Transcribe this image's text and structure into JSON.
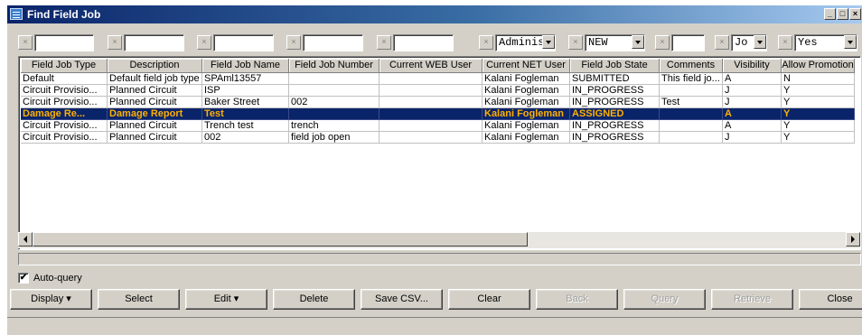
{
  "window": {
    "title": "Find Field Job"
  },
  "filters": [
    {
      "value": "",
      "dropdown": false
    },
    {
      "value": "",
      "dropdown": false
    },
    {
      "value": "",
      "dropdown": false
    },
    {
      "value": "",
      "dropdown": false
    },
    {
      "value": "",
      "dropdown": false
    },
    {
      "value": "Adminis",
      "dropdown": true
    },
    {
      "value": "NEW",
      "dropdown": true
    },
    {
      "value": "",
      "dropdown": false
    },
    {
      "value": "Jo",
      "dropdown": true
    },
    {
      "value": "Yes",
      "dropdown": true
    }
  ],
  "table": {
    "columns": [
      "Field Job Type",
      "Description",
      "Field Job Name",
      "Field Job Number",
      "Current WEB User",
      "Current NET User",
      "Field Job State",
      "Comments",
      "Visibility",
      "Allow Promotion"
    ],
    "rows": [
      [
        "Default",
        "Default field job type",
        "SPAml13557",
        "",
        "",
        "Kalani Fogleman",
        "SUBMITTED",
        "This field jo...",
        "A",
        "N"
      ],
      [
        "Circuit Provisio...",
        "Planned Circuit",
        "ISP",
        "",
        "",
        "Kalani Fogleman",
        "IN_PROGRESS",
        "",
        "J",
        "Y"
      ],
      [
        "Circuit Provisio...",
        "Planned Circuit",
        "Baker Street",
        "002",
        "",
        "Kalani Fogleman",
        "IN_PROGRESS",
        "Test",
        "J",
        "Y"
      ],
      [
        "Damage Re...",
        "Damage Report",
        "Test",
        "",
        "",
        "Kalani Fogleman",
        "ASSIGNED",
        "",
        "A",
        "Y"
      ],
      [
        "Circuit Provisio...",
        "Planned Circuit",
        "Trench test",
        "trench",
        "",
        "Kalani Fogleman",
        "IN_PROGRESS",
        "",
        "A",
        "Y"
      ],
      [
        "Circuit Provisio...",
        "Planned Circuit",
        "002",
        "field job open",
        "",
        "Kalani Fogleman",
        "IN_PROGRESS",
        "",
        "J",
        "Y"
      ]
    ],
    "selected_row": 3
  },
  "auto_query": {
    "label": "Auto-query",
    "checked": true,
    "mark": "✔"
  },
  "buttons": [
    {
      "label": "Display ▾",
      "enabled": true
    },
    {
      "label": "Select",
      "enabled": true
    },
    {
      "label": "Edit ▾",
      "enabled": true
    },
    {
      "label": "Delete",
      "enabled": true
    },
    {
      "label": "Save CSV...",
      "enabled": true
    },
    {
      "label": "Clear",
      "enabled": true
    },
    {
      "label": "Back",
      "enabled": false
    },
    {
      "label": "Query",
      "enabled": false
    },
    {
      "label": "Retrieve",
      "enabled": false
    },
    {
      "label": "Close",
      "enabled": true
    }
  ],
  "colors": {
    "selection": "#0a246a",
    "selection_text": "#ffb000",
    "titlebar": "#0a246a"
  }
}
